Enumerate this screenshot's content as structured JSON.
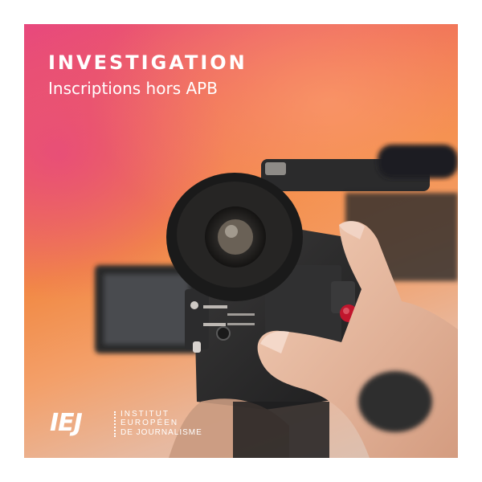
{
  "headline": "INVESTIGATION",
  "subline": "Inscriptions hors APB",
  "logo": {
    "mark": "IEJ",
    "line1": "INSTITUT",
    "line2": "EUROPÉEN",
    "line3": "DE JOURNALISME"
  },
  "colors": {
    "gradient_pink": "#e8487d",
    "gradient_orange": "#f28a45",
    "text": "#ffffff"
  },
  "photo_subject": "hand-holding-video-camera"
}
